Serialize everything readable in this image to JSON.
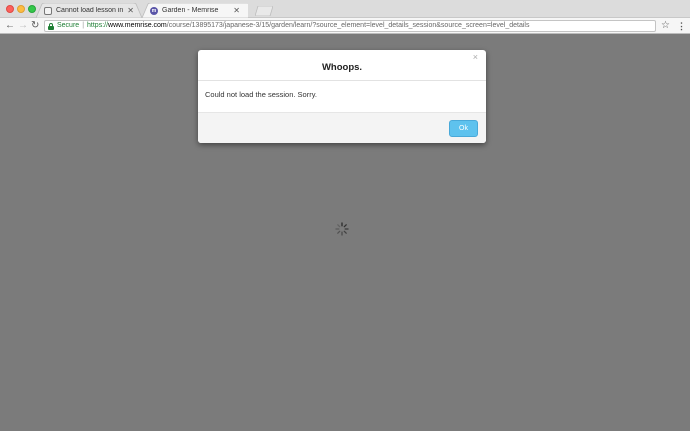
{
  "browser": {
    "tabs": [
      {
        "title": "Cannot load lesson in Japane",
        "active": false,
        "icon": "chat-bubble-icon"
      },
      {
        "title": "Garden - Memrise",
        "active": true,
        "icon": "memrise-icon"
      }
    ],
    "address_bar": {
      "secure_label": "Secure",
      "separator": "|",
      "url_scheme": "https://",
      "url_host": "www.memrise.com",
      "url_path": "/course/13895173/japanese-3/15/garden/learn/?source_element=level_details_session&source_screen=level_details"
    }
  },
  "dialog": {
    "title": "Whoops.",
    "message": "Could not load the session. Sorry.",
    "ok_label": "Ok",
    "close_glyph": "×"
  },
  "colors": {
    "backdrop": "#7b7b7b",
    "ok_button": "#5ec2ee",
    "secure_green": "#1e7e34"
  }
}
